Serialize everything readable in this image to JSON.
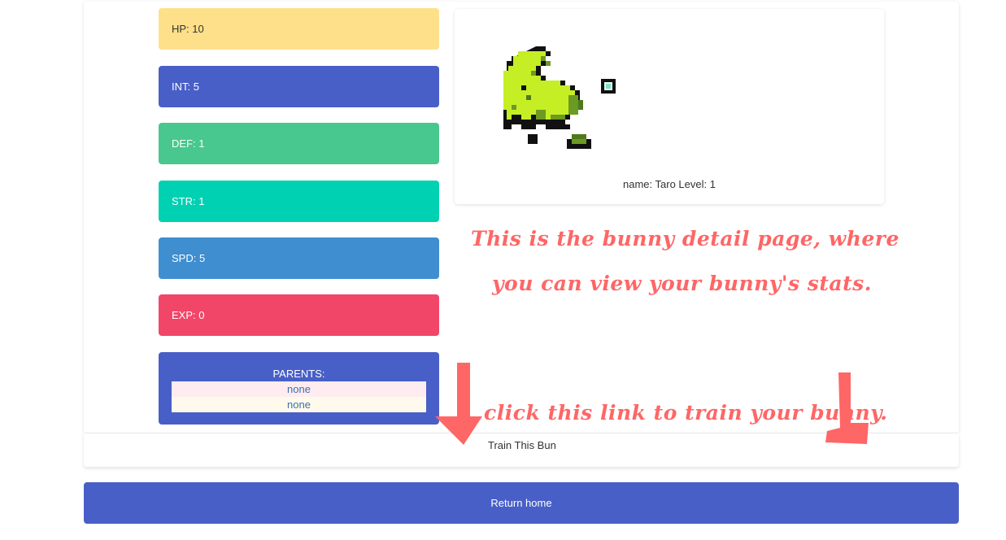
{
  "stats": [
    {
      "key": "hp",
      "label": "HP:",
      "value": "10",
      "color": "#ffe08a"
    },
    {
      "key": "int",
      "label": "INT:",
      "value": "5",
      "color": "#485fc7"
    },
    {
      "key": "def",
      "label": "DEF:",
      "value": "1",
      "color": "#48c78e"
    },
    {
      "key": "str",
      "label": "STR:",
      "value": "1",
      "color": "#00d1b2"
    },
    {
      "key": "spd",
      "label": "SPD:",
      "value": "5",
      "color": "#3e8ed0"
    },
    {
      "key": "exp",
      "label": "EXP:",
      "value": "0",
      "color": "#f14668"
    }
  ],
  "parents": {
    "title": "PARENTS:",
    "items": [
      "none",
      "none"
    ],
    "box_color": "#485fc7",
    "row_colors": [
      "#feecf0",
      "#fffaeb"
    ],
    "link_color": "#3e6fb0"
  },
  "bunny": {
    "caption": "name: Taro Level: 1",
    "sprite": "pixel-art-green-bunny"
  },
  "annotations": {
    "line1": "This is the bunny detail page, where",
    "line2": "you can view your bunny's stats.",
    "line3": "click this link to train your bunny.",
    "color": "#ff6666"
  },
  "train_link": "Train This Bun",
  "return_button": {
    "label": "Return home",
    "color": "#485fc7"
  }
}
